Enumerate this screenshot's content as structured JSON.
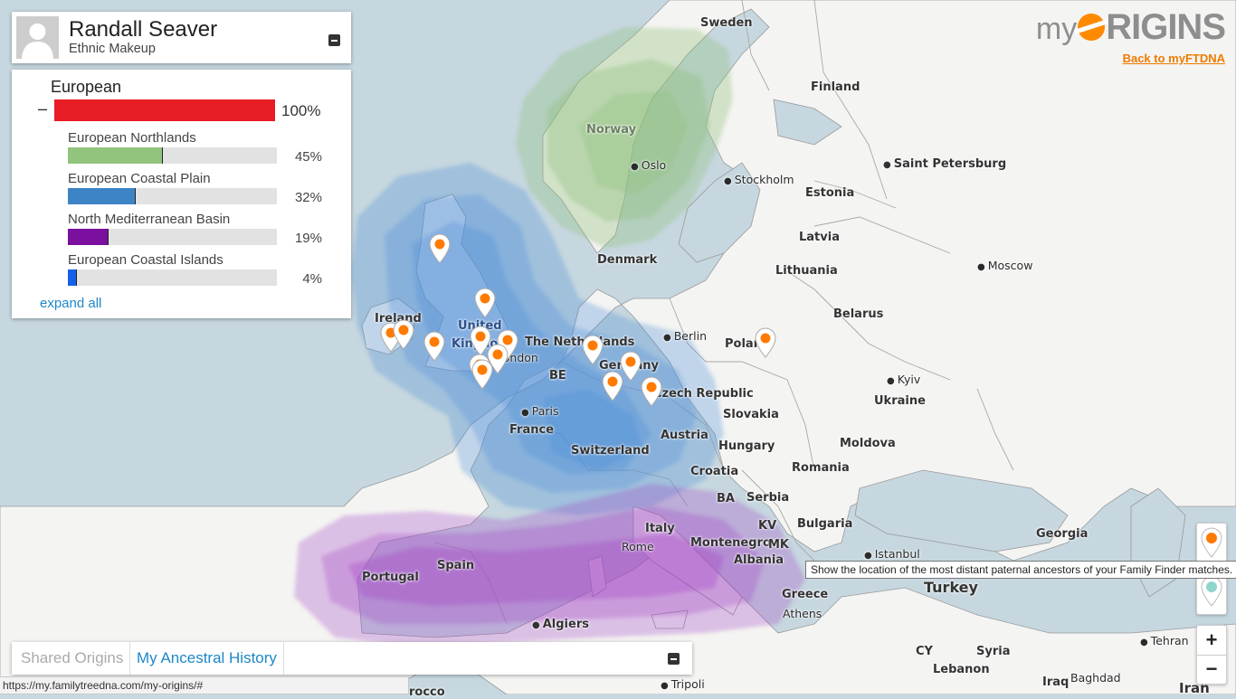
{
  "profile": {
    "name": "Randall Seaver",
    "subtitle": "Ethnic Makeup",
    "avatar_icon": "user-silhouette-icon"
  },
  "ethnic": {
    "group": {
      "label": "European",
      "toggle": "–",
      "percent_label": "100%",
      "percent": 100,
      "color": "#e81c24"
    },
    "components": [
      {
        "label": "European Northlands",
        "percent_label": "45%",
        "percent": 45,
        "color": "#93c47d"
      },
      {
        "label": "European Coastal Plain",
        "percent_label": "32%",
        "percent": 32,
        "color": "#3d84c6"
      },
      {
        "label": "North Mediterranean Basin",
        "percent_label": "19%",
        "percent": 19,
        "color": "#7b0f9e"
      },
      {
        "label": "European Coastal Islands",
        "percent_label": "4%",
        "percent": 4,
        "color": "#1560e8"
      }
    ],
    "expand_label": "expand all"
  },
  "logo": {
    "text_my": "my",
    "text_rigins": "RIGINS",
    "accent_color": "#ff8a00",
    "back_link": "Back to myFTDNA"
  },
  "tabs": {
    "shared": "Shared Origins",
    "ancestral": "My Ancestral History"
  },
  "status_bar": "https://my.familytreedna.com/my-origins/#",
  "controls": {
    "zoom_in": "+",
    "zoom_out": "−",
    "tooltip": "Show the location of the most distant paternal ancestors of your Family Finder matches.",
    "paternal_pin_color": "#ff7a00",
    "maternal_pin_color": "#8fd6cc"
  },
  "map": {
    "labels": {
      "sweden": "Sweden",
      "finland": "Finland",
      "norway": "Norway",
      "oslo": "Oslo",
      "stockholm": "Stockholm",
      "saint_petersburg": "Saint Petersburg",
      "estonia": "Estonia",
      "latvia": "Latvia",
      "denmark": "Denmark",
      "lithuania": "Lithuania",
      "moscow": "Moscow",
      "ireland": "Ireland",
      "united_kingdom_1": "United",
      "united_kingdom_2": "Kingdom",
      "london": "London",
      "netherlands": "The Netherlands",
      "berlin": "Berlin",
      "poland": "Poland",
      "belarus": "Belarus",
      "be": "BE",
      "germany": "Germany",
      "czech": "Czech Republic",
      "kyiv": "Kyiv",
      "ukraine": "Ukraine",
      "paris": "Paris",
      "france": "France",
      "slovakia": "Slovakia",
      "austria": "Austria",
      "hungary": "Hungary",
      "moldova": "Moldova",
      "switzerland": "Switzerland",
      "romania": "Romania",
      "croatia": "Croatia",
      "ba": "BA",
      "serbia": "Serbia",
      "italy": "Italy",
      "kv": "KV",
      "bulgaria": "Bulgaria",
      "georgia": "Georgia",
      "rome": "Rome",
      "montenegro": "Montenegro",
      "mk": "MK",
      "albania": "Albania",
      "istanbul": "Istanbul",
      "portugal": "Portugal",
      "spain": "Spain",
      "greece": "Greece",
      "turkey": "Turkey",
      "athens": "Athens",
      "algiers": "Algiers",
      "tehran": "Tehran",
      "cy": "CY",
      "syria": "Syria",
      "lebanon": "Lebanon",
      "iraq": "Iraq",
      "baghdad": "Baghdad",
      "tripoli": "Tripoli",
      "iran": "Iran",
      "morocco_partial": "rocco"
    }
  }
}
